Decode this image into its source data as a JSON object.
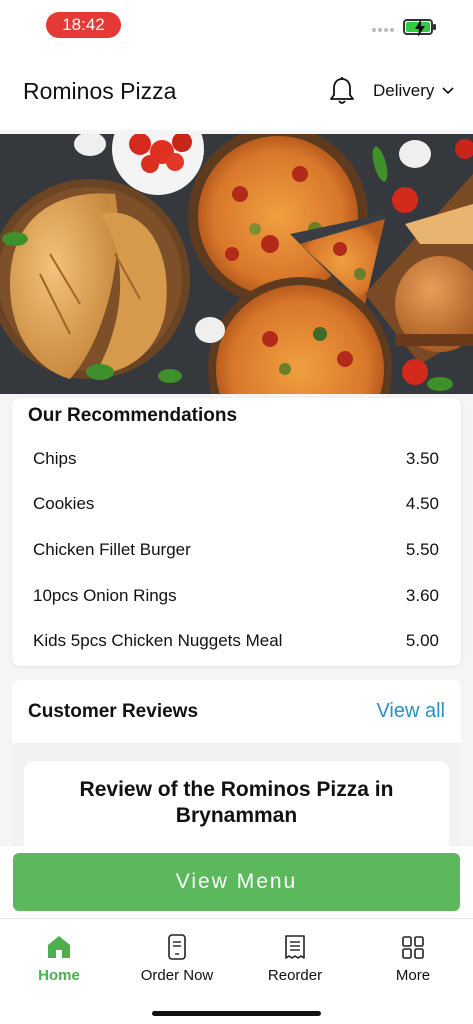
{
  "status_bar": {
    "time": "18:42"
  },
  "header": {
    "title": "Rominos Pizza",
    "delivery_label": "Delivery",
    "icons": {
      "bell": "bell-icon",
      "chevron": "chevron-down-icon"
    }
  },
  "recommendations": {
    "title": "Our Recommendations",
    "items": [
      {
        "name": "Chips",
        "price": "3.50"
      },
      {
        "name": "Cookies",
        "price": "4.50"
      },
      {
        "name": "Chicken Fillet Burger",
        "price": "5.50"
      },
      {
        "name": "10pcs Onion Rings",
        "price": "3.60"
      },
      {
        "name": "Kids 5pcs Chicken Nuggets Meal",
        "price": "5.00"
      }
    ]
  },
  "reviews": {
    "title": "Customer Reviews",
    "view_all": "View all",
    "card_title": "Review of the Rominos Pizza in Brynamman"
  },
  "cta": {
    "view_menu": "View Menu"
  },
  "tabs": [
    {
      "label": "Home",
      "icon": "home-icon",
      "active": true
    },
    {
      "label": "Order Now",
      "icon": "order-icon",
      "active": false
    },
    {
      "label": "Reorder",
      "icon": "receipt-icon",
      "active": false
    },
    {
      "label": "More",
      "icon": "grid-icon",
      "active": false
    }
  ],
  "colors": {
    "time_pill": "#e53935",
    "accent_green": "#5cb85c",
    "link_blue": "#2a90c0",
    "battery_green": "#2ecc40"
  }
}
